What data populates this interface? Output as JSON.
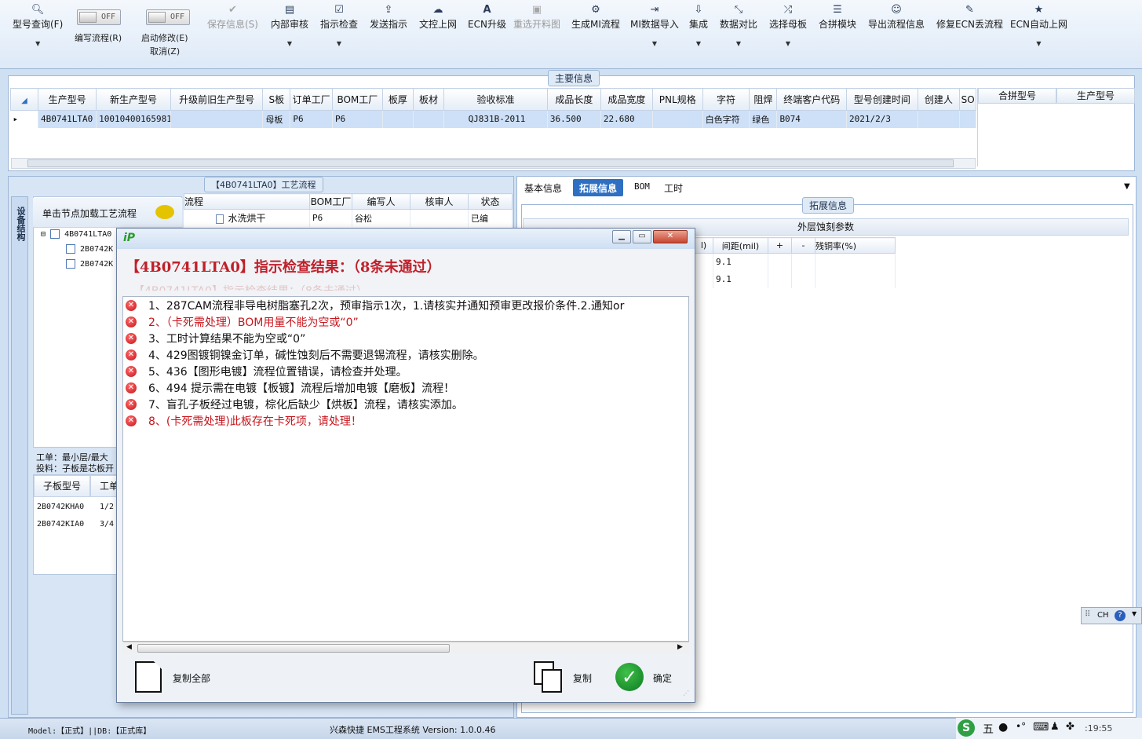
{
  "toolbar": {
    "items": [
      {
        "label": "型号查询(F)",
        "icon": "search-icon"
      },
      {
        "label": "保存信息(S)",
        "icon": "check-icon"
      },
      {
        "label": "内部审核",
        "icon": "printer-icon"
      },
      {
        "label": "指示检查",
        "icon": "checkbox-icon"
      },
      {
        "label": "发送指示",
        "icon": "upload-icon"
      },
      {
        "label": "文控上网",
        "icon": "cloud-upload-icon"
      },
      {
        "label": "ECN升级",
        "icon": "font-a-icon"
      },
      {
        "label": "重选开料图",
        "icon": "image-icon"
      },
      {
        "label": "生成MI流程",
        "icon": "cogs-icon"
      },
      {
        "label": "MI数据导入",
        "icon": "sign-in-icon"
      },
      {
        "label": "集成",
        "icon": "download-icon"
      },
      {
        "label": "数据对比",
        "icon": "compress-icon"
      },
      {
        "label": "选择母板",
        "icon": "random-icon"
      },
      {
        "label": "合拼模块",
        "icon": "list-icon"
      },
      {
        "label": "导出流程信息",
        "icon": "smile-icon"
      },
      {
        "label": "修复ECN丢流程",
        "icon": "wrench-icon"
      },
      {
        "label": "ECN自动上网",
        "icon": "star-icon"
      }
    ],
    "toggle_edit": {
      "state": "OFF",
      "label": "编写流程(R)"
    },
    "toggle_modify": {
      "state": "OFF",
      "label": "启动修改(E)",
      "label2": "取消(Z)"
    }
  },
  "main_info": {
    "title": "主要信息",
    "columns": [
      "生产型号",
      "新生产型号",
      "升级前旧生产型号",
      "S板",
      "订单工厂",
      "BOM工厂",
      "板厚",
      "板材",
      "验收标准",
      "成品长度",
      "成品宽度",
      "PNL规格",
      "字符",
      "阻焊",
      "终端客户代码",
      "型号创建时间",
      "创建人",
      "SO"
    ],
    "row": [
      "4B0741LTA0",
      "10010400165981",
      "",
      "母板",
      "P6",
      "P6",
      "",
      "",
      "QJ831B-2011",
      "36.500",
      "22.680",
      "",
      "白色字符",
      "绿色",
      "B074",
      "2021/2/3",
      "",
      ""
    ],
    "side_columns": [
      "合拼型号",
      "生产型号"
    ]
  },
  "process": {
    "title": "【4B0741LTA0】工艺流程",
    "side_tab": "设备结构",
    "node_button": "单击节点加载工艺流程",
    "tree": [
      "4B0741LTA0",
      "2B0742K",
      "2B0742K"
    ],
    "grid_columns": [
      "流程",
      "BOM工厂",
      "编写人",
      "核审人",
      "状态"
    ],
    "grid_row": [
      "水洗烘干",
      "P6",
      "谷松",
      "",
      "已编"
    ],
    "info_line1": "工单：最小层/最大",
    "info_line2": "投料：子板是芯板开",
    "sub_columns": [
      "子板型号",
      "工单"
    ],
    "sub_rows": [
      [
        "2B0742KHA0",
        "1/2"
      ],
      [
        "2B0742KIA0",
        "3/4"
      ]
    ]
  },
  "ext": {
    "tabs": [
      "基本信息",
      "拓展信息",
      "BOM",
      "工时"
    ],
    "active_tab": "拓展信息",
    "title": "拓展信息",
    "etch_title": "外层蚀刻参数",
    "etch_columns": [
      "l)",
      "间距(mil)",
      "+",
      "-",
      "残铜率(%)"
    ],
    "etch_rows": [
      [
        "",
        "9.1",
        "",
        "",
        ""
      ],
      [
        "",
        "9.1",
        "",
        "",
        ""
      ]
    ]
  },
  "dialog": {
    "header": "【4B0741LTA0】指示检查结果：（8条未通过）",
    "header_ghost": "【4B0741LTA0】指示检查结果：（8条未通过）",
    "items": [
      {
        "text": "1、287CAM流程非导电树脂塞孔2次，预审指示1次，1.请核实并通知预审更改报价条件.2.通知or",
        "red": false
      },
      {
        "text": "2、（卡死需处理）BOM用量不能为空或“0”",
        "red": true
      },
      {
        "text": "3、工时计算结果不能为空或“0”",
        "red": false
      },
      {
        "text": "4、429图镀铜镍金订单，碱性蚀刻后不需要退锡流程，请核实删除。",
        "red": false
      },
      {
        "text": "5、436【图形电镀】流程位置错误，请检查并处理。",
        "red": false
      },
      {
        "text": "6、494 提示需在电镀【板镀】流程后增加电镀【磨板】流程！",
        "red": false
      },
      {
        "text": "7、盲孔子板经过电镀，棕化后缺少【烘板】流程，请核实添加。",
        "red": false
      },
      {
        "text": "8、(卡死需处理)此板存在卡死项，请处理！",
        "red": true
      }
    ],
    "copy_all_label": "复制全部",
    "copy_label": "复制",
    "ok_label": "确定"
  },
  "status": {
    "model": "Model:【正式】||DB:【正式库】",
    "app": "兴森快捷 EMS工程系统 Version: 1.0.0.46",
    "time": ":19:55",
    "ime_mode": "五",
    "lang": "CH"
  }
}
